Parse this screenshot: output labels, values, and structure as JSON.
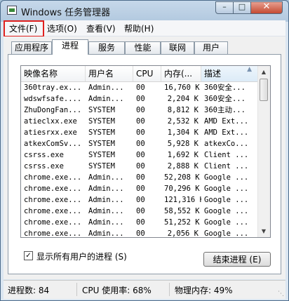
{
  "window": {
    "title": "Windows 任务管理器",
    "minimize": "–",
    "maximize": "□",
    "close": "✕"
  },
  "menu": [
    "文件(F)",
    "选项(O)",
    "查看(V)",
    "帮助(H)"
  ],
  "tabs": [
    "应用程序",
    "进程",
    "服务",
    "性能",
    "联网",
    "用户"
  ],
  "active_tab": "进程",
  "columns": [
    "映像名称",
    "用户名",
    "CPU",
    "内存(...",
    "描述"
  ],
  "processes": [
    {
      "name": "360tray.ex...",
      "user": "Admin...",
      "cpu": "00",
      "mem": "16,760 K",
      "desc": "360安全..."
    },
    {
      "name": "wdswfsafe....",
      "user": "Admin...",
      "cpu": "00",
      "mem": "2,204 K",
      "desc": "360安全..."
    },
    {
      "name": "ZhuDongFan...",
      "user": "SYSTEM",
      "cpu": "00",
      "mem": "8,812 K",
      "desc": "360主动..."
    },
    {
      "name": "atieclxx.exe",
      "user": "SYSTEM",
      "cpu": "00",
      "mem": "2,532 K",
      "desc": "AMD Ext..."
    },
    {
      "name": "atiesrxx.exe",
      "user": "SYSTEM",
      "cpu": "00",
      "mem": "1,304 K",
      "desc": "AMD Ext..."
    },
    {
      "name": "atkexComSv...",
      "user": "SYSTEM",
      "cpu": "00",
      "mem": "5,928 K",
      "desc": "atkexCo..."
    },
    {
      "name": "csrss.exe",
      "user": "SYSTEM",
      "cpu": "00",
      "mem": "1,692 K",
      "desc": "Client ..."
    },
    {
      "name": "csrss.exe",
      "user": "SYSTEM",
      "cpu": "00",
      "mem": "2,888 K",
      "desc": "Client ..."
    },
    {
      "name": "chrome.exe...",
      "user": "Admin...",
      "cpu": "00",
      "mem": "52,208 K",
      "desc": "Google ..."
    },
    {
      "name": "chrome.exe...",
      "user": "Admin...",
      "cpu": "00",
      "mem": "70,296 K",
      "desc": "Google ..."
    },
    {
      "name": "chrome.exe...",
      "user": "Admin...",
      "cpu": "00",
      "mem": "121,316 K",
      "desc": "Google ..."
    },
    {
      "name": "chrome.exe...",
      "user": "Admin...",
      "cpu": "00",
      "mem": "58,552 K",
      "desc": "Google ..."
    },
    {
      "name": "chrome.exe...",
      "user": "Admin...",
      "cpu": "00",
      "mem": "51,252 K",
      "desc": "Google ..."
    },
    {
      "name": "chrome.exe...",
      "user": "Admin...",
      "cpu": "00",
      "mem": "2,056 K",
      "desc": "Google ..."
    },
    {
      "name": "chrome.exe...",
      "user": "Admin...",
      "cpu": "00",
      "mem": "5,372 K",
      "desc": "Google ..."
    }
  ],
  "show_all_label": "显示所有用户的进程 (S)",
  "show_all_checked": true,
  "end_process_label": "结束进程 (E)",
  "status": {
    "processes": "进程数: 84",
    "cpu": "CPU 使用率: 68%",
    "memory": "物理内存: 49%"
  },
  "colors": {
    "highlight_box": "#e0201e",
    "title_bar": "#b2c9df"
  },
  "icons": {
    "sort": "sort-up-icon",
    "checkbox": "check-icon"
  }
}
